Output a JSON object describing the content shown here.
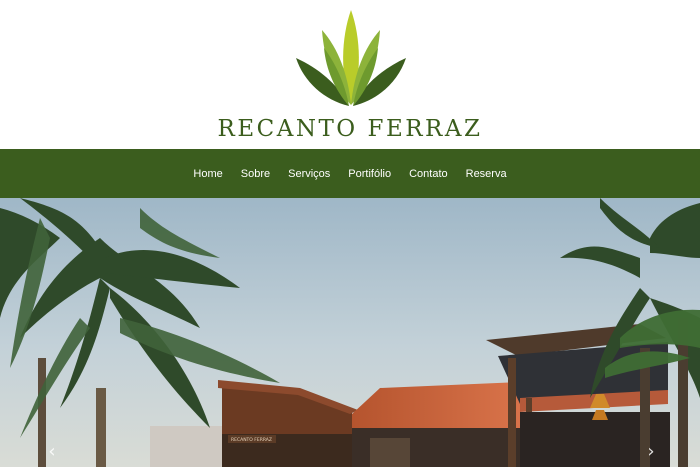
{
  "brand": {
    "name": "RECANTO FERRAZ",
    "logo_icon": "leaf-logo-icon",
    "colors": {
      "dark_green": "#3b5d1e",
      "mid_green": "#6e9a2e",
      "light_green": "#b9cc2a"
    }
  },
  "nav": {
    "items": [
      {
        "label": "Home"
      },
      {
        "label": "Sobre"
      },
      {
        "label": "Serviços"
      },
      {
        "label": "Portifólio"
      },
      {
        "label": "Contato"
      },
      {
        "label": "Reserva"
      }
    ]
  },
  "hero": {
    "image": "outdoor-venue-photo",
    "sign_text": "RECANTO FERRAZ",
    "prev_icon": "chevron-left-icon",
    "next_icon": "chevron-right-icon",
    "prev_glyph": "‹",
    "next_glyph": "›"
  }
}
